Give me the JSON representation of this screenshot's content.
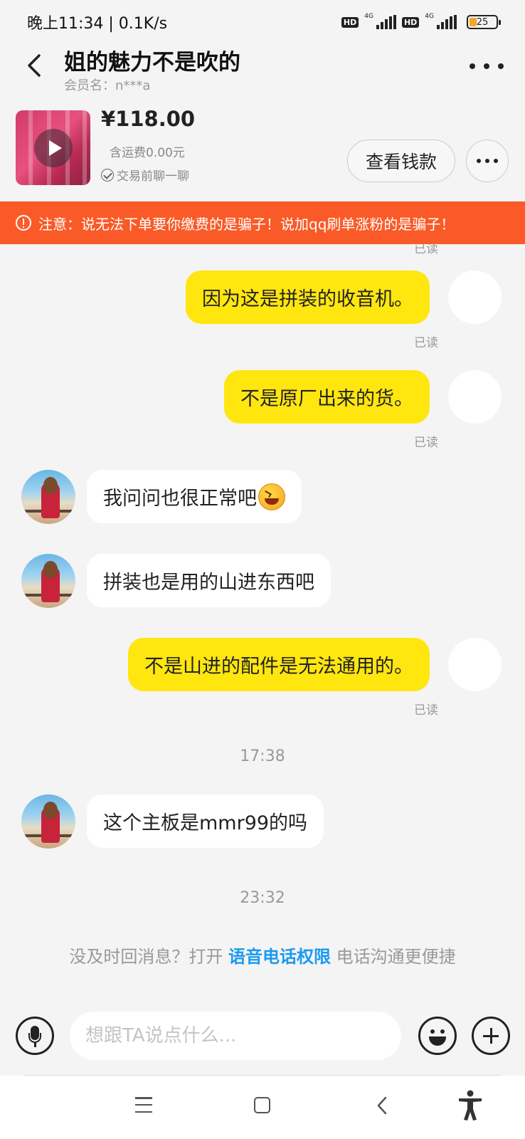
{
  "status_bar": {
    "time": "晚上11:34 | 0.1K/s",
    "hd1": "HD",
    "net1": "4G",
    "hd2": "HD",
    "net2": "4G",
    "battery": "25"
  },
  "header": {
    "title": "姐的魅力不是吹的",
    "member": "会员名：n***a"
  },
  "product": {
    "price": "¥118.00",
    "shipping": "含运费0.00元",
    "chat_first": "交易前聊一聊",
    "view_button": "查看钱款"
  },
  "warning": {
    "text": "注意：说无法下单要你缴费的是骗子！说加qq刷单涨粉的是骗子！"
  },
  "messages": [
    {
      "from": "me",
      "text": "因为这是拼装的收音机。",
      "status": "已读"
    },
    {
      "from": "me",
      "text": "不是原厂出来的货。",
      "status": "已读"
    },
    {
      "from": "them",
      "text": "我问问也很正常吧",
      "emoji": "laughing-emoji"
    },
    {
      "from": "them",
      "text": "拼装也是用的山进东西吧"
    },
    {
      "from": "me",
      "text": "不是山进的配件是无法通用的。",
      "status": "已读"
    },
    {
      "from": "them",
      "text": "这个主板是mmr99的吗"
    }
  ],
  "read_peek": "已读",
  "timestamps": [
    "17:38",
    "23:32"
  ],
  "hint": {
    "prefix": "没及时回消息？打开 ",
    "link": "语音电话权限",
    "suffix": " 电话沟通更便捷"
  },
  "input": {
    "placeholder": "想跟TA说点什么..."
  },
  "colors": {
    "my_bubble": "#ffe60f",
    "warning_bg": "#fa5a27",
    "link": "#1a9af0"
  },
  "icons": [
    "back-icon",
    "more-icon",
    "play-icon",
    "check-circle-icon",
    "warning-icon",
    "mic-icon",
    "emoji-icon",
    "plus-icon",
    "menu-icon",
    "home-icon",
    "back-nav-icon",
    "accessibility-icon"
  ]
}
